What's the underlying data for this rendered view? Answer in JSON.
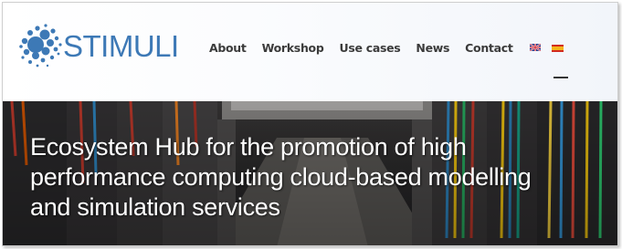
{
  "brand": {
    "name": "STIMULI",
    "logo_icon": "stimuli-dots-logo-icon",
    "color": "#3d79b6"
  },
  "nav": {
    "items": [
      {
        "label": "About"
      },
      {
        "label": "Workshop"
      },
      {
        "label": "Use cases"
      },
      {
        "label": "News"
      },
      {
        "label": "Contact"
      }
    ],
    "languages": [
      {
        "icon": "uk-flag-icon",
        "active": true
      },
      {
        "icon": "spain-flag-icon",
        "active": false
      }
    ]
  },
  "hero": {
    "title_lines": [
      "Ecosystem Hub for the promotion of high",
      "performance computing cloud-based modelling",
      "and simulation services"
    ],
    "background": "server-room-photo"
  }
}
